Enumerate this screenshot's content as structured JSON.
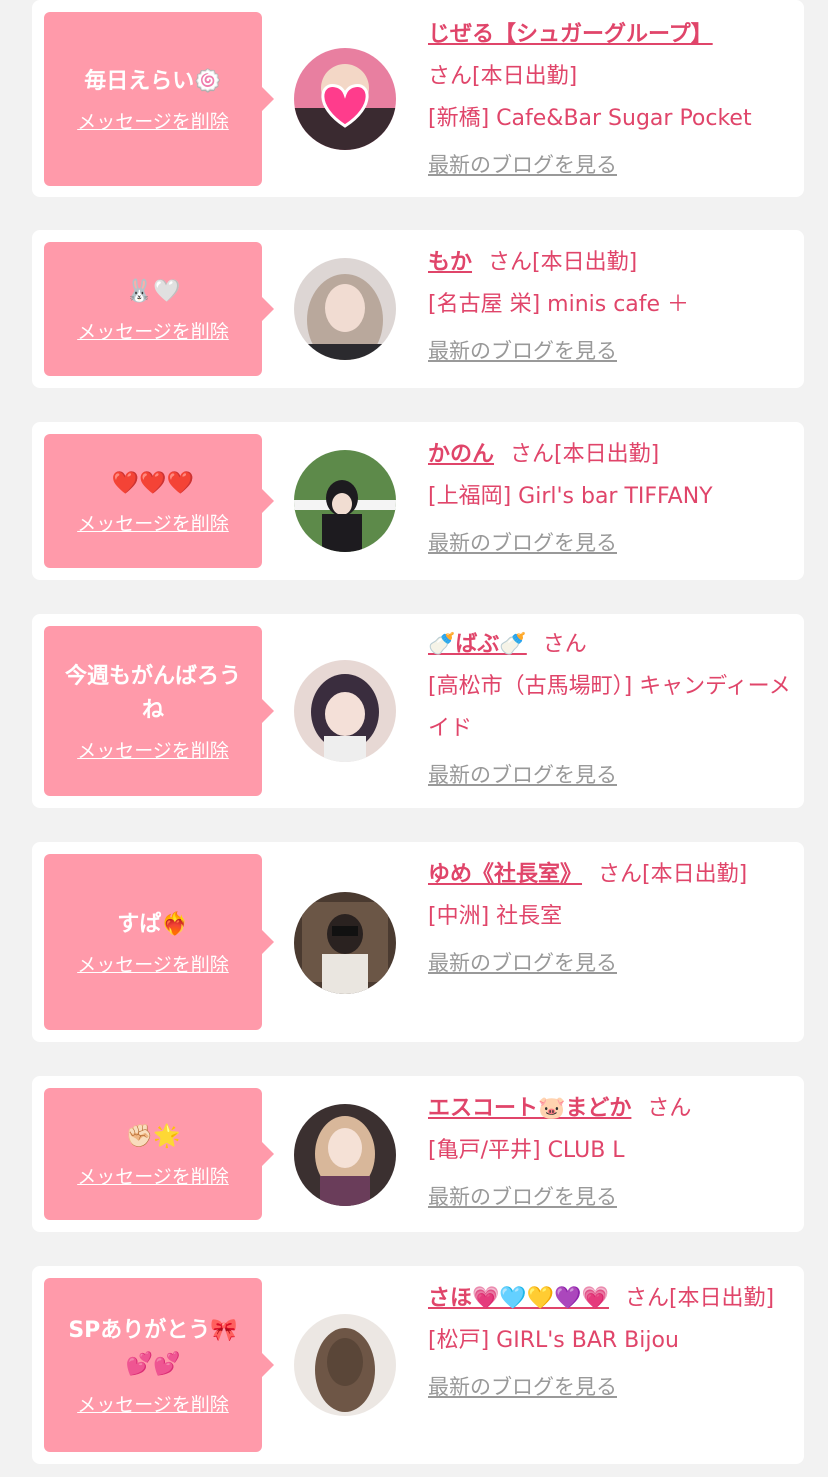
{
  "common": {
    "delete_label": "メッセージを削除",
    "blog_label": "最新のブログを見る",
    "san_suffix": "さん",
    "accent_color": "#e0456a",
    "bubble_color": "#ff9aaa"
  },
  "items": [
    {
      "message": "毎日えらい🍥",
      "name": "じぜる【シュガーグループ】",
      "status": "さん[本日出勤]",
      "shop": "[新橋] Cafe&Bar Sugar Pocket",
      "avatar_icon": "heart-sticker-avatar"
    },
    {
      "message": "🐰🤍",
      "name": "もか",
      "status": "さん[本日出勤]",
      "shop": "[名古屋 栄] minis cafe ＋",
      "avatar_icon": "girl-photo-avatar"
    },
    {
      "message": "❤️❤️❤️",
      "name": "かのん",
      "status": "さん[本日出勤]",
      "shop": "[上福岡] Girl's bar TIFFANY",
      "avatar_icon": "girl-photo-avatar"
    },
    {
      "message": "今週もがんばろうね",
      "name": "🍼ばぶ🍼",
      "status": "さん",
      "shop": "[高松市（古馬場町）] キャンディーメイド",
      "avatar_icon": "girl-photo-avatar"
    },
    {
      "message": "すぱ❤️‍🔥",
      "name": "ゆめ《社長室》",
      "status": "さん[本日出勤]",
      "shop": "[中洲] 社長室",
      "avatar_icon": "girl-photo-avatar"
    },
    {
      "message": "✊🏻🌟",
      "name": "エスコート🐷まどか",
      "status": "さん",
      "shop": "[亀戸/平井] CLUB L",
      "avatar_icon": "girl-photo-avatar"
    },
    {
      "message": "SPありがとう🎀💕💕",
      "name": "さほ💗🩵💛💜💗",
      "status": "さん[本日出勤]",
      "shop": "[松戸] GIRL's BAR Bijou",
      "avatar_icon": "girl-photo-avatar"
    }
  ]
}
